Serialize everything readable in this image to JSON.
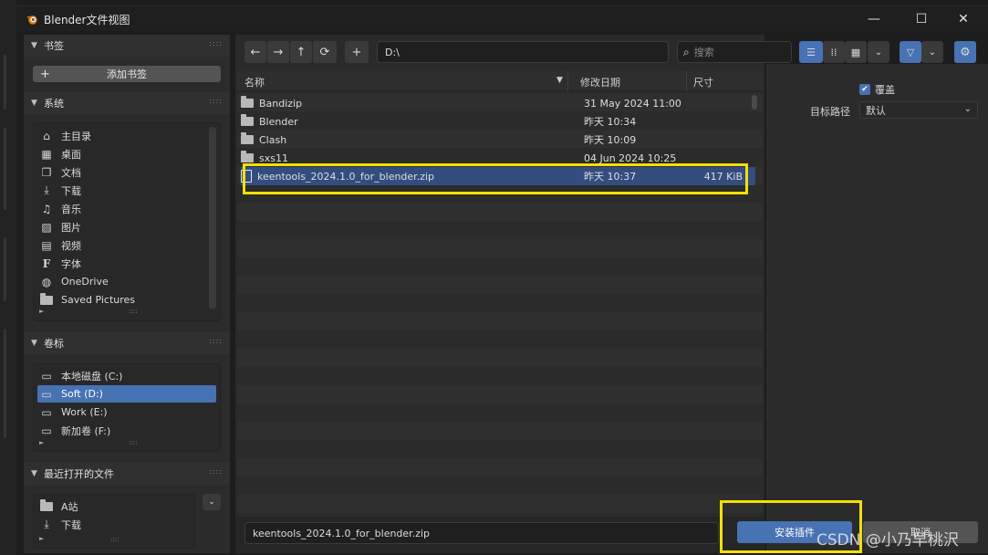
{
  "window": {
    "title": "Blender文件视图",
    "minimize": "—",
    "maximize": "☐",
    "close": "✕"
  },
  "sidebar": {
    "bookmarks": {
      "label": "书签",
      "add_label": "添加书签"
    },
    "system": {
      "label": "系统",
      "items": [
        {
          "label": "主目录",
          "icon": "home-icon"
        },
        {
          "label": "桌面",
          "icon": "desktop-icon"
        },
        {
          "label": "文档",
          "icon": "documents-icon"
        },
        {
          "label": "下载",
          "icon": "download-icon"
        },
        {
          "label": "音乐",
          "icon": "music-icon"
        },
        {
          "label": "图片",
          "icon": "image-icon"
        },
        {
          "label": "视频",
          "icon": "film-icon"
        },
        {
          "label": "字体",
          "icon": "font-icon"
        },
        {
          "label": "OneDrive",
          "icon": "globe-icon"
        },
        {
          "label": "Saved Pictures",
          "icon": "folder-icon"
        }
      ]
    },
    "volumes": {
      "label": "卷标",
      "items": [
        {
          "label": "本地磁盘 (C:)",
          "selected": false
        },
        {
          "label": "Soft (D:)",
          "selected": true
        },
        {
          "label": "Work (E:)",
          "selected": false
        },
        {
          "label": "新加卷 (F:)",
          "selected": false
        }
      ]
    },
    "recent": {
      "label": "最近打开的文件",
      "items": [
        {
          "label": "A站",
          "icon": "folder-icon"
        },
        {
          "label": "下载",
          "icon": "download-icon"
        }
      ]
    }
  },
  "toolbar": {
    "back": "←",
    "forward": "→",
    "parent": "↑",
    "refresh": "⟳",
    "new_folder": "+",
    "path": "D:\\",
    "search_placeholder": "搜索"
  },
  "columns": {
    "name": "名称",
    "modified": "修改日期",
    "size": "尺寸"
  },
  "files": [
    {
      "name": "Bandizip",
      "date": "31 May 2024 11:00",
      "size": "",
      "type": "folder",
      "selected": false
    },
    {
      "name": "Blender",
      "date": "昨天 10:34",
      "size": "",
      "type": "folder",
      "selected": false
    },
    {
      "name": "Clash",
      "date": "昨天 10:09",
      "size": "",
      "type": "folder",
      "selected": false
    },
    {
      "name": "sxs11",
      "date": "04 Jun 2024 10:25",
      "size": "",
      "type": "folder",
      "selected": false
    },
    {
      "name": "keentools_2024.1.0_for_blender.zip",
      "date": "昨天 10:37",
      "size": "417 KiB",
      "type": "zip",
      "selected": true
    }
  ],
  "footer": {
    "filename": "keentools_2024.1.0_for_blender.zip",
    "install_label": "安装插件",
    "cancel_label": "取消"
  },
  "options": {
    "overwrite_label": "覆盖",
    "overwrite_checked": true,
    "target_path_label": "目标路径",
    "target_path_value": "默认"
  },
  "watermark": "CSDN @小乃早桃沢",
  "colors": {
    "accent": "#4772b3",
    "highlight": "#f5e000",
    "selected_row": "#334d80"
  }
}
